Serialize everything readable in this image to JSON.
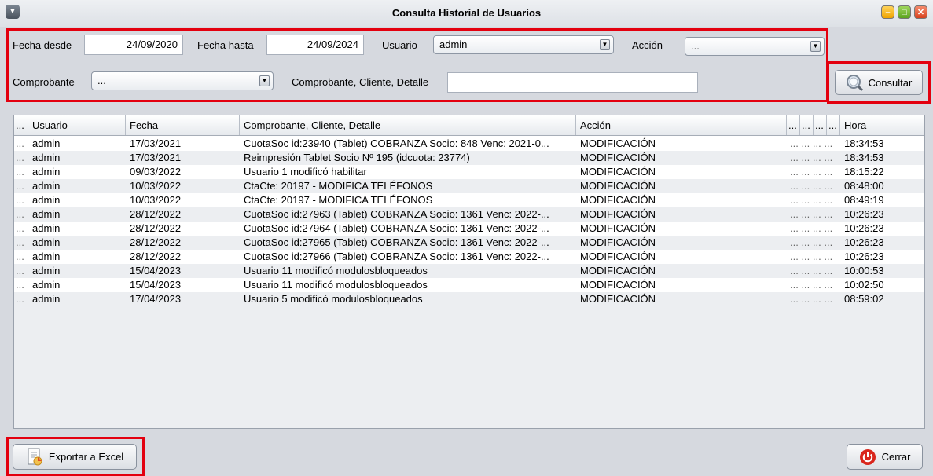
{
  "window": {
    "title": "Consulta Historial de Usuarios"
  },
  "filters": {
    "fecha_desde_label": "Fecha desde",
    "fecha_desde_value": "24/09/2020",
    "fecha_hasta_label": "Fecha hasta",
    "fecha_hasta_value": "24/09/2024",
    "usuario_label": "Usuario",
    "usuario_value": "admin",
    "accion_label": "Acción",
    "accion_value": "...",
    "comprobante_label": "Comprobante",
    "comprobante_value": "...",
    "detalle_label": "Comprobante, Cliente, Detalle",
    "detalle_value": ""
  },
  "buttons": {
    "consultar": "Consultar",
    "exportar": "Exportar a Excel",
    "cerrar": "Cerrar"
  },
  "table": {
    "columns": [
      "...",
      "Usuario",
      "Fecha",
      "Comprobante, Cliente, Detalle",
      "Acción",
      "...",
      "...",
      "...",
      "...",
      "Hora"
    ],
    "rows": [
      {
        "usuario": "admin",
        "fecha": "17/03/2021",
        "detalle": "CuotaSoc id:23940 (Tablet) COBRANZA Socio: 848 Venc: 2021-0...",
        "accion": "MODIFICACIÓN",
        "hora": "18:34:53"
      },
      {
        "usuario": "admin",
        "fecha": "17/03/2021",
        "detalle": "Reimpresión Tablet Socio Nº 195 (idcuota: 23774)",
        "accion": "MODIFICACIÓN",
        "hora": "18:34:53"
      },
      {
        "usuario": "admin",
        "fecha": "09/03/2022",
        "detalle": "Usuario 1 modificó habilitar",
        "accion": "MODIFICACIÓN",
        "hora": "18:15:22"
      },
      {
        "usuario": "admin",
        "fecha": "10/03/2022",
        "detalle": "CtaCte: 20197 - MODIFICA TELÉFONOS",
        "accion": "MODIFICACIÓN",
        "hora": "08:48:00"
      },
      {
        "usuario": "admin",
        "fecha": "10/03/2022",
        "detalle": "CtaCte: 20197 - MODIFICA TELÉFONOS",
        "accion": "MODIFICACIÓN",
        "hora": "08:49:19"
      },
      {
        "usuario": "admin",
        "fecha": "28/12/2022",
        "detalle": "CuotaSoc id:27963 (Tablet) COBRANZA Socio: 1361 Venc: 2022-...",
        "accion": "MODIFICACIÓN",
        "hora": "10:26:23"
      },
      {
        "usuario": "admin",
        "fecha": "28/12/2022",
        "detalle": "CuotaSoc id:27964 (Tablet) COBRANZA Socio: 1361 Venc: 2022-...",
        "accion": "MODIFICACIÓN",
        "hora": "10:26:23"
      },
      {
        "usuario": "admin",
        "fecha": "28/12/2022",
        "detalle": "CuotaSoc id:27965 (Tablet) COBRANZA Socio: 1361 Venc: 2022-...",
        "accion": "MODIFICACIÓN",
        "hora": "10:26:23"
      },
      {
        "usuario": "admin",
        "fecha": "28/12/2022",
        "detalle": "CuotaSoc id:27966 (Tablet) COBRANZA Socio: 1361 Venc: 2022-...",
        "accion": "MODIFICACIÓN",
        "hora": "10:26:23"
      },
      {
        "usuario": "admin",
        "fecha": "15/04/2023",
        "detalle": "Usuario 11 modificó modulosbloqueados",
        "accion": "MODIFICACIÓN",
        "hora": "10:00:53"
      },
      {
        "usuario": "admin",
        "fecha": "15/04/2023",
        "detalle": "Usuario 11 modificó modulosbloqueados",
        "accion": "MODIFICACIÓN",
        "hora": "10:02:50"
      },
      {
        "usuario": "admin",
        "fecha": "17/04/2023",
        "detalle": "Usuario 5 modificó modulosbloqueados",
        "accion": "MODIFICACIÓN",
        "hora": "08:59:02"
      }
    ],
    "row_dots": "...",
    "row_dots_group": "...  ...  ...  ..."
  },
  "colors": {
    "highlight": "#e3000f",
    "row_alt": "#eceef1",
    "window_bg": "#d6d9df"
  },
  "icons": {
    "sysmenu": "chevron-down-icon",
    "consultar": "magnifier-icon",
    "exportar": "excel-document-icon",
    "cerrar": "power-icon"
  }
}
